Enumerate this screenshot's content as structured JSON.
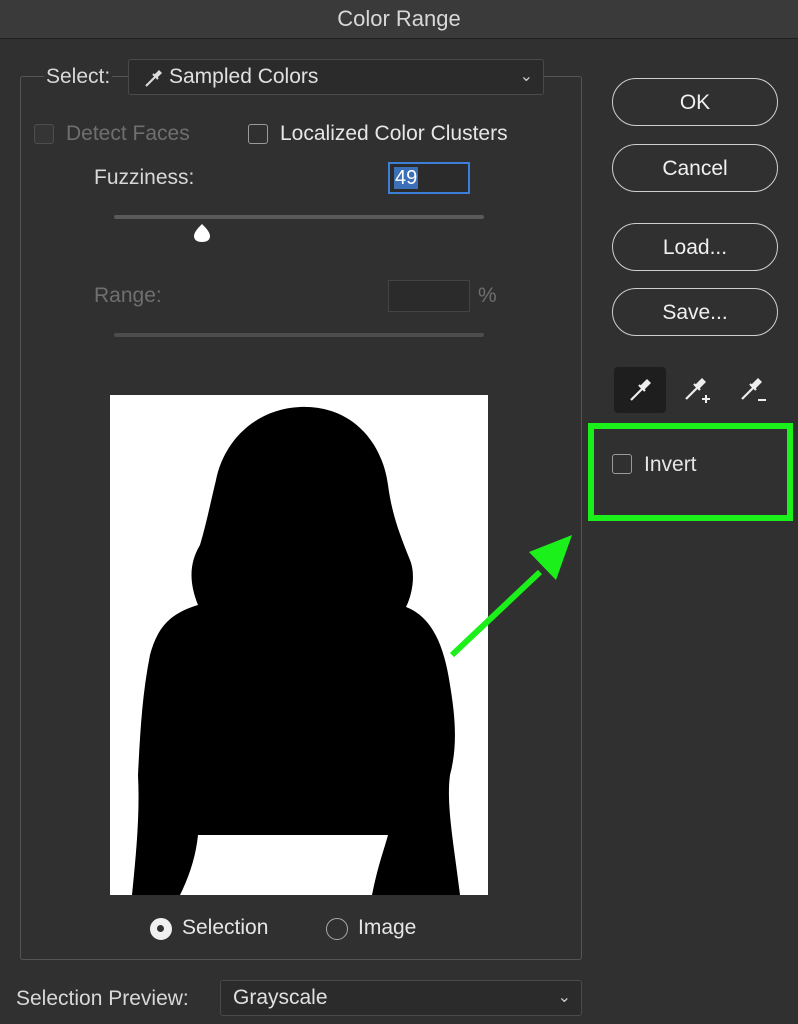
{
  "window": {
    "title": "Color Range"
  },
  "select": {
    "label": "Select:",
    "value": "Sampled Colors"
  },
  "options": {
    "detect_faces": {
      "label": "Detect Faces",
      "checked": false,
      "enabled": false
    },
    "localized_clusters": {
      "label": "Localized Color Clusters",
      "checked": false
    }
  },
  "fuzziness": {
    "label": "Fuzziness:",
    "value": "49"
  },
  "range": {
    "label": "Range:",
    "value": "",
    "unit": "%"
  },
  "buttons": {
    "ok": "OK",
    "cancel": "Cancel",
    "load": "Load...",
    "save": "Save..."
  },
  "eyedroppers": [
    "eyedropper-icon",
    "eyedropper-plus-icon",
    "eyedropper-minus-icon"
  ],
  "invert": {
    "label": "Invert",
    "checked": false
  },
  "view": {
    "selection_label": "Selection",
    "image_label": "Image",
    "selected": "selection"
  },
  "selection_preview": {
    "label": "Selection Preview:",
    "value": "Grayscale"
  },
  "colors": {
    "highlight": "#1bf01b",
    "accent": "#3d7fd8",
    "background": "#303030"
  }
}
